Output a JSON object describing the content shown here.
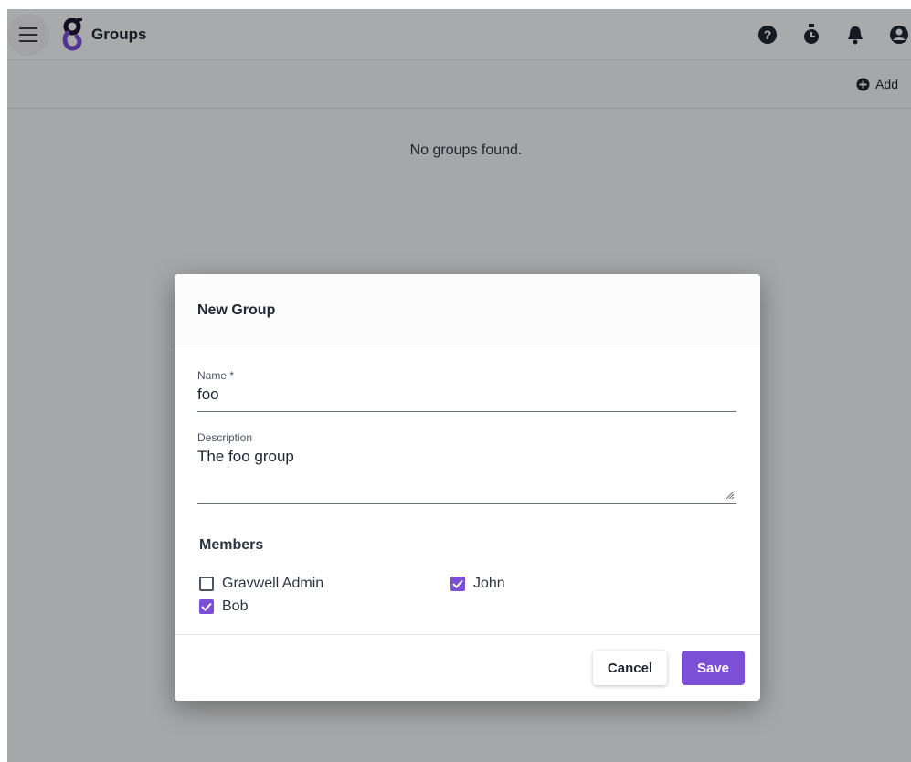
{
  "app": {
    "title": "Groups",
    "icons": [
      "menu-icon",
      "gravwell-logo",
      "help-icon",
      "timer-icon",
      "bell-icon",
      "account-icon"
    ]
  },
  "toolbar": {
    "add_label": "Add",
    "add_icon": "plus-circle-icon"
  },
  "main": {
    "empty_message": "No groups found."
  },
  "dialog": {
    "title": "New Group",
    "name_label": "Name *",
    "name_value": "foo",
    "description_label": "Description",
    "description_value": "The foo group",
    "members_title": "Members",
    "members": [
      {
        "label": "Gravwell Admin",
        "checked": false
      },
      {
        "label": "John",
        "checked": true
      },
      {
        "label": "Bob",
        "checked": true
      }
    ],
    "cancel_label": "Cancel",
    "save_label": "Save"
  },
  "colors": {
    "accent": "#7b4fd6",
    "text": "#1f2732",
    "overlay": "rgba(0,0,0,0.32)"
  }
}
